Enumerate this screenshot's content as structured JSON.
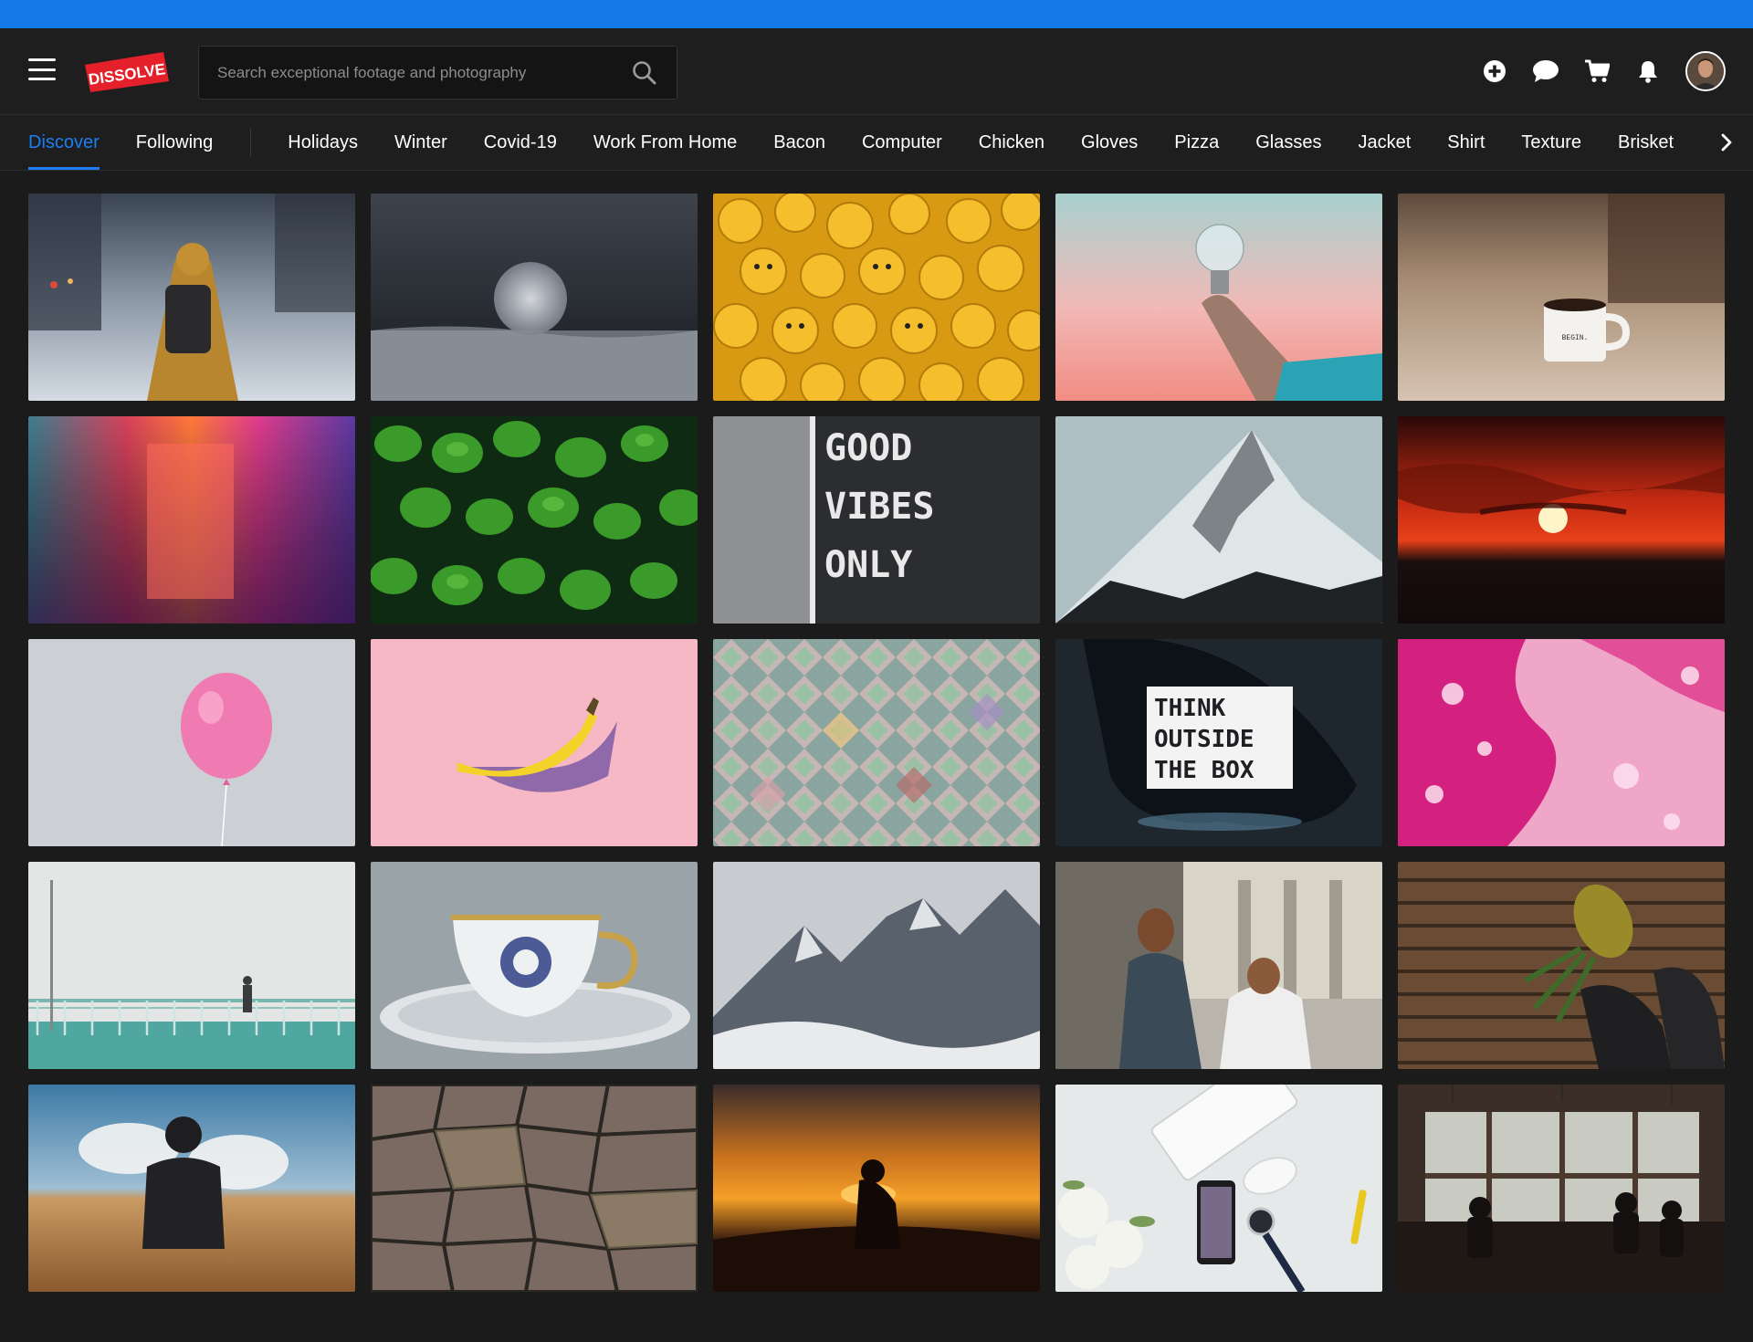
{
  "header": {
    "brand": "DISSOLVE",
    "search_placeholder": "Search exceptional footage and photography",
    "actions": [
      "plus-circle-icon",
      "chat-icon",
      "cart-icon",
      "bell-icon",
      "user-avatar"
    ]
  },
  "tabs": {
    "items": [
      "Discover",
      "Following",
      "Holidays",
      "Winter",
      "Covid-19",
      "Work From Home",
      "Bacon",
      "Computer",
      "Chicken",
      "Gloves",
      "Pizza",
      "Glasses",
      "Jacket",
      "Shirt",
      "Texture",
      "Brisket"
    ],
    "active": "Discover"
  },
  "tile_texts": {
    "coffee_mug": "BEGIN.",
    "letterboard": [
      "GOOD",
      "VIBES",
      "ONLY"
    ],
    "lightbox": [
      "THINK",
      "OUTSIDE",
      "THE BOX"
    ]
  },
  "colors": {
    "accent": "#1c7ef0",
    "topbar": "#1479e6",
    "background": "#1b1b1c",
    "brand_red": "#e4202a"
  }
}
